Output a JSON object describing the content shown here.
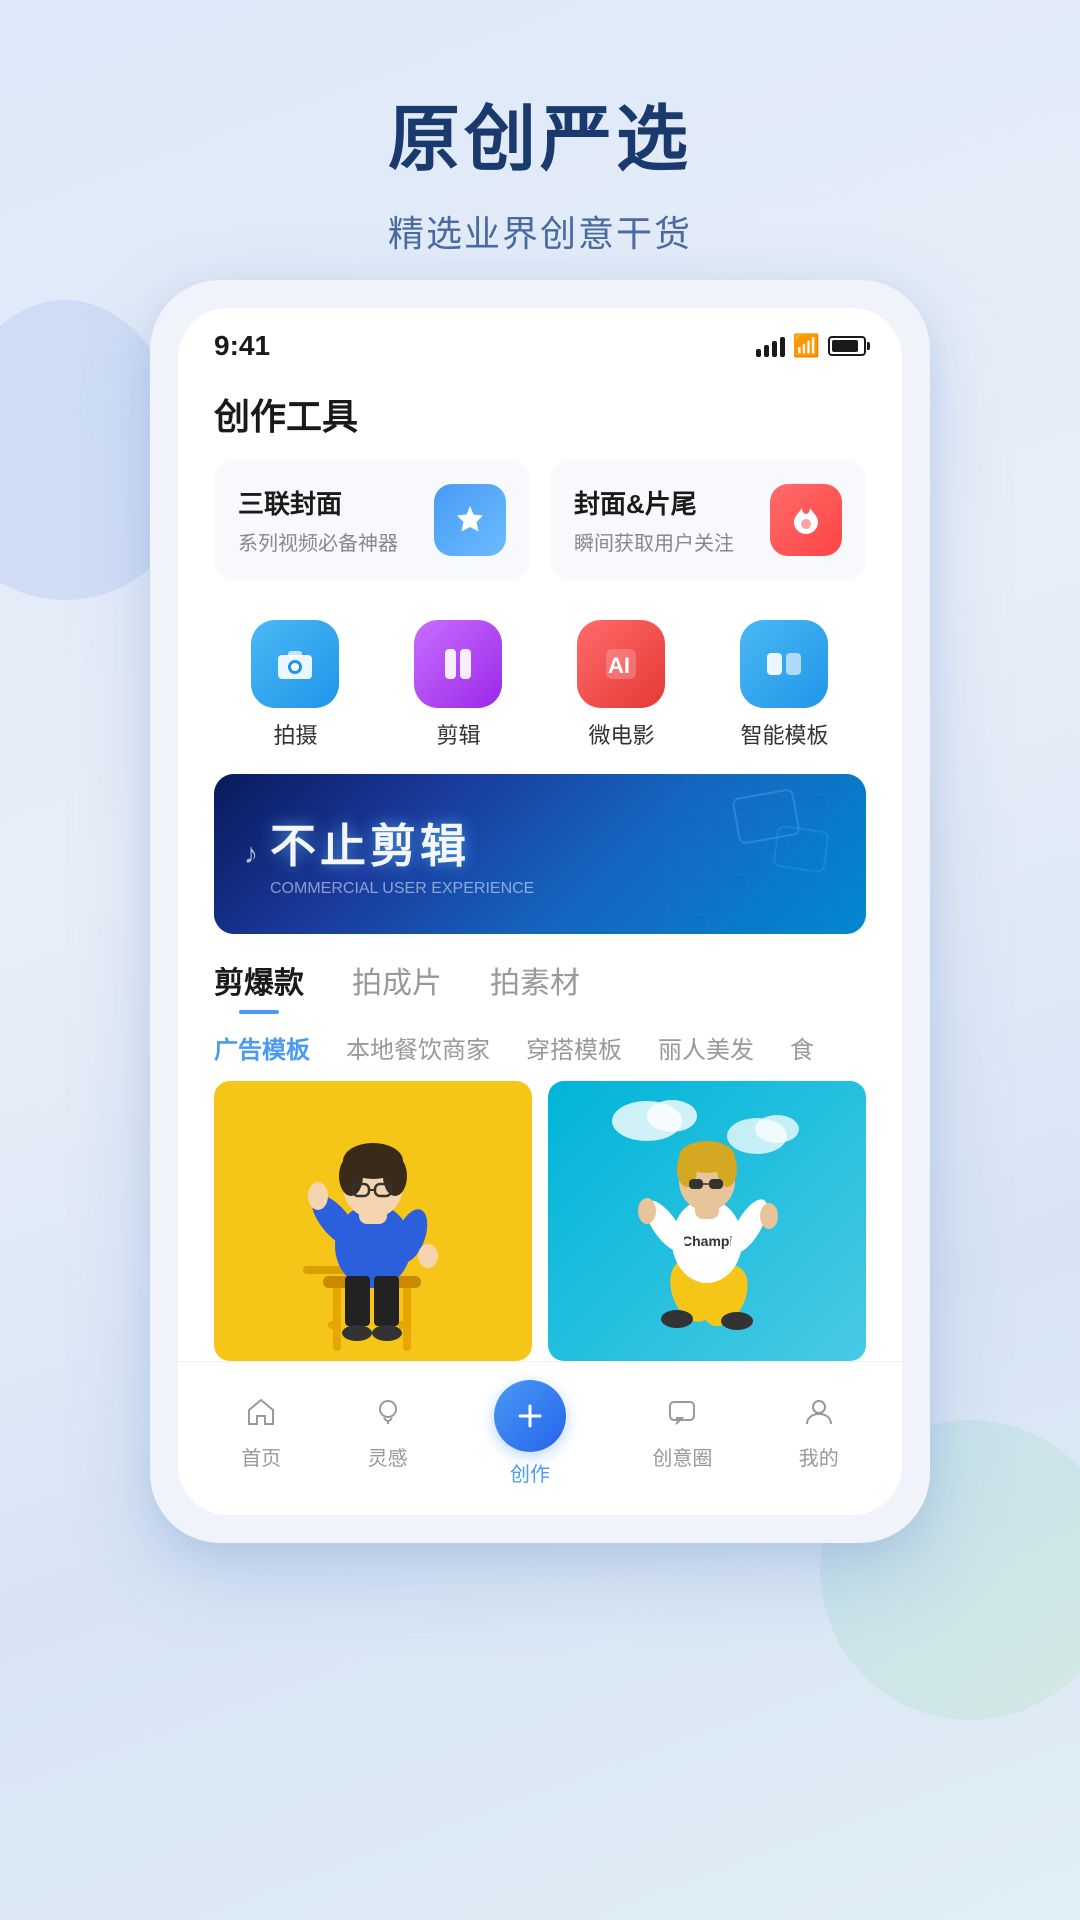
{
  "app": {
    "background_title": "原创严选",
    "background_subtitle": "精选业界创意干货"
  },
  "status_bar": {
    "time": "9:41"
  },
  "page": {
    "title": "创作工具"
  },
  "tool_cards": [
    {
      "name": "三联封面",
      "desc": "系列视频必备神器",
      "icon_type": "star",
      "icon_color": "blue"
    },
    {
      "name": "封面&片尾",
      "desc": "瞬间获取用户关注",
      "icon_type": "flame",
      "icon_color": "red"
    }
  ],
  "icon_grid": [
    {
      "name": "拍摄",
      "type": "camera",
      "color": "camera"
    },
    {
      "name": "剪辑",
      "type": "scissors",
      "color": "edit"
    },
    {
      "name": "微电影",
      "type": "ai",
      "color": "ai"
    },
    {
      "name": "智能模板",
      "type": "template",
      "color": "template"
    }
  ],
  "banner": {
    "text": "不止剪辑",
    "subtext": "COMMERCIAL USER EXPERIENCE"
  },
  "main_tabs": [
    {
      "label": "剪爆款",
      "active": true
    },
    {
      "label": "拍成片",
      "active": false
    },
    {
      "label": "拍素材",
      "active": false
    }
  ],
  "sub_tabs": [
    {
      "label": "广告模板",
      "active": true
    },
    {
      "label": "本地餐饮商家",
      "active": false
    },
    {
      "label": "穿搭模板",
      "active": false
    },
    {
      "label": "丽人美发",
      "active": false
    },
    {
      "label": "食",
      "active": false
    }
  ],
  "bottom_nav": [
    {
      "label": "首页",
      "icon": "home",
      "active": false
    },
    {
      "label": "灵感",
      "icon": "lightbulb",
      "active": false
    },
    {
      "label": "创作",
      "icon": "plus",
      "active": true,
      "is_create": true
    },
    {
      "label": "创意圈",
      "icon": "chat",
      "active": false
    },
    {
      "label": "我的",
      "icon": "user",
      "active": false
    }
  ]
}
